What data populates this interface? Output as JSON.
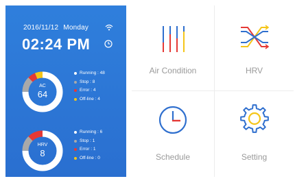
{
  "status": {
    "date": "2016/11/12",
    "weekday": "Monday",
    "time": "02:24 PM"
  },
  "ac": {
    "name": "AC",
    "count": "64",
    "running_label": "Running : 48",
    "stop_label": "Stop : 8",
    "error_label": "Error : 4",
    "offline_label": "Off-line : 4",
    "running": 48,
    "stop": 8,
    "error": 4,
    "offline": 4
  },
  "hrv": {
    "name": "HRV",
    "count": "8",
    "running_label": "Running : 6",
    "stop_label": "Stop : 1",
    "error_label": "Error : 1",
    "offline_label": "Off-line : 0",
    "running": 6,
    "stop": 1,
    "error": 1,
    "offline": 0
  },
  "tiles": {
    "air_condition": "Air Condition",
    "hrv": "HRV",
    "schedule": "Schedule",
    "setting": "Setting"
  },
  "colors": {
    "panel": "#2f7fdc",
    "running": "#ffffff",
    "stop": "#a9a9a9",
    "error": "#e53935",
    "offline": "#f5c518",
    "icon_blue": "#2f6fce",
    "icon_red": "#e53935",
    "icon_yellow": "#f5c518"
  },
  "icons": {
    "wifi": "wifi-icon",
    "clock": "clock-icon",
    "air_condition": "sliders-icon",
    "hrv": "airflow-icon",
    "schedule": "schedule-clock-icon",
    "setting": "gear-icon"
  }
}
